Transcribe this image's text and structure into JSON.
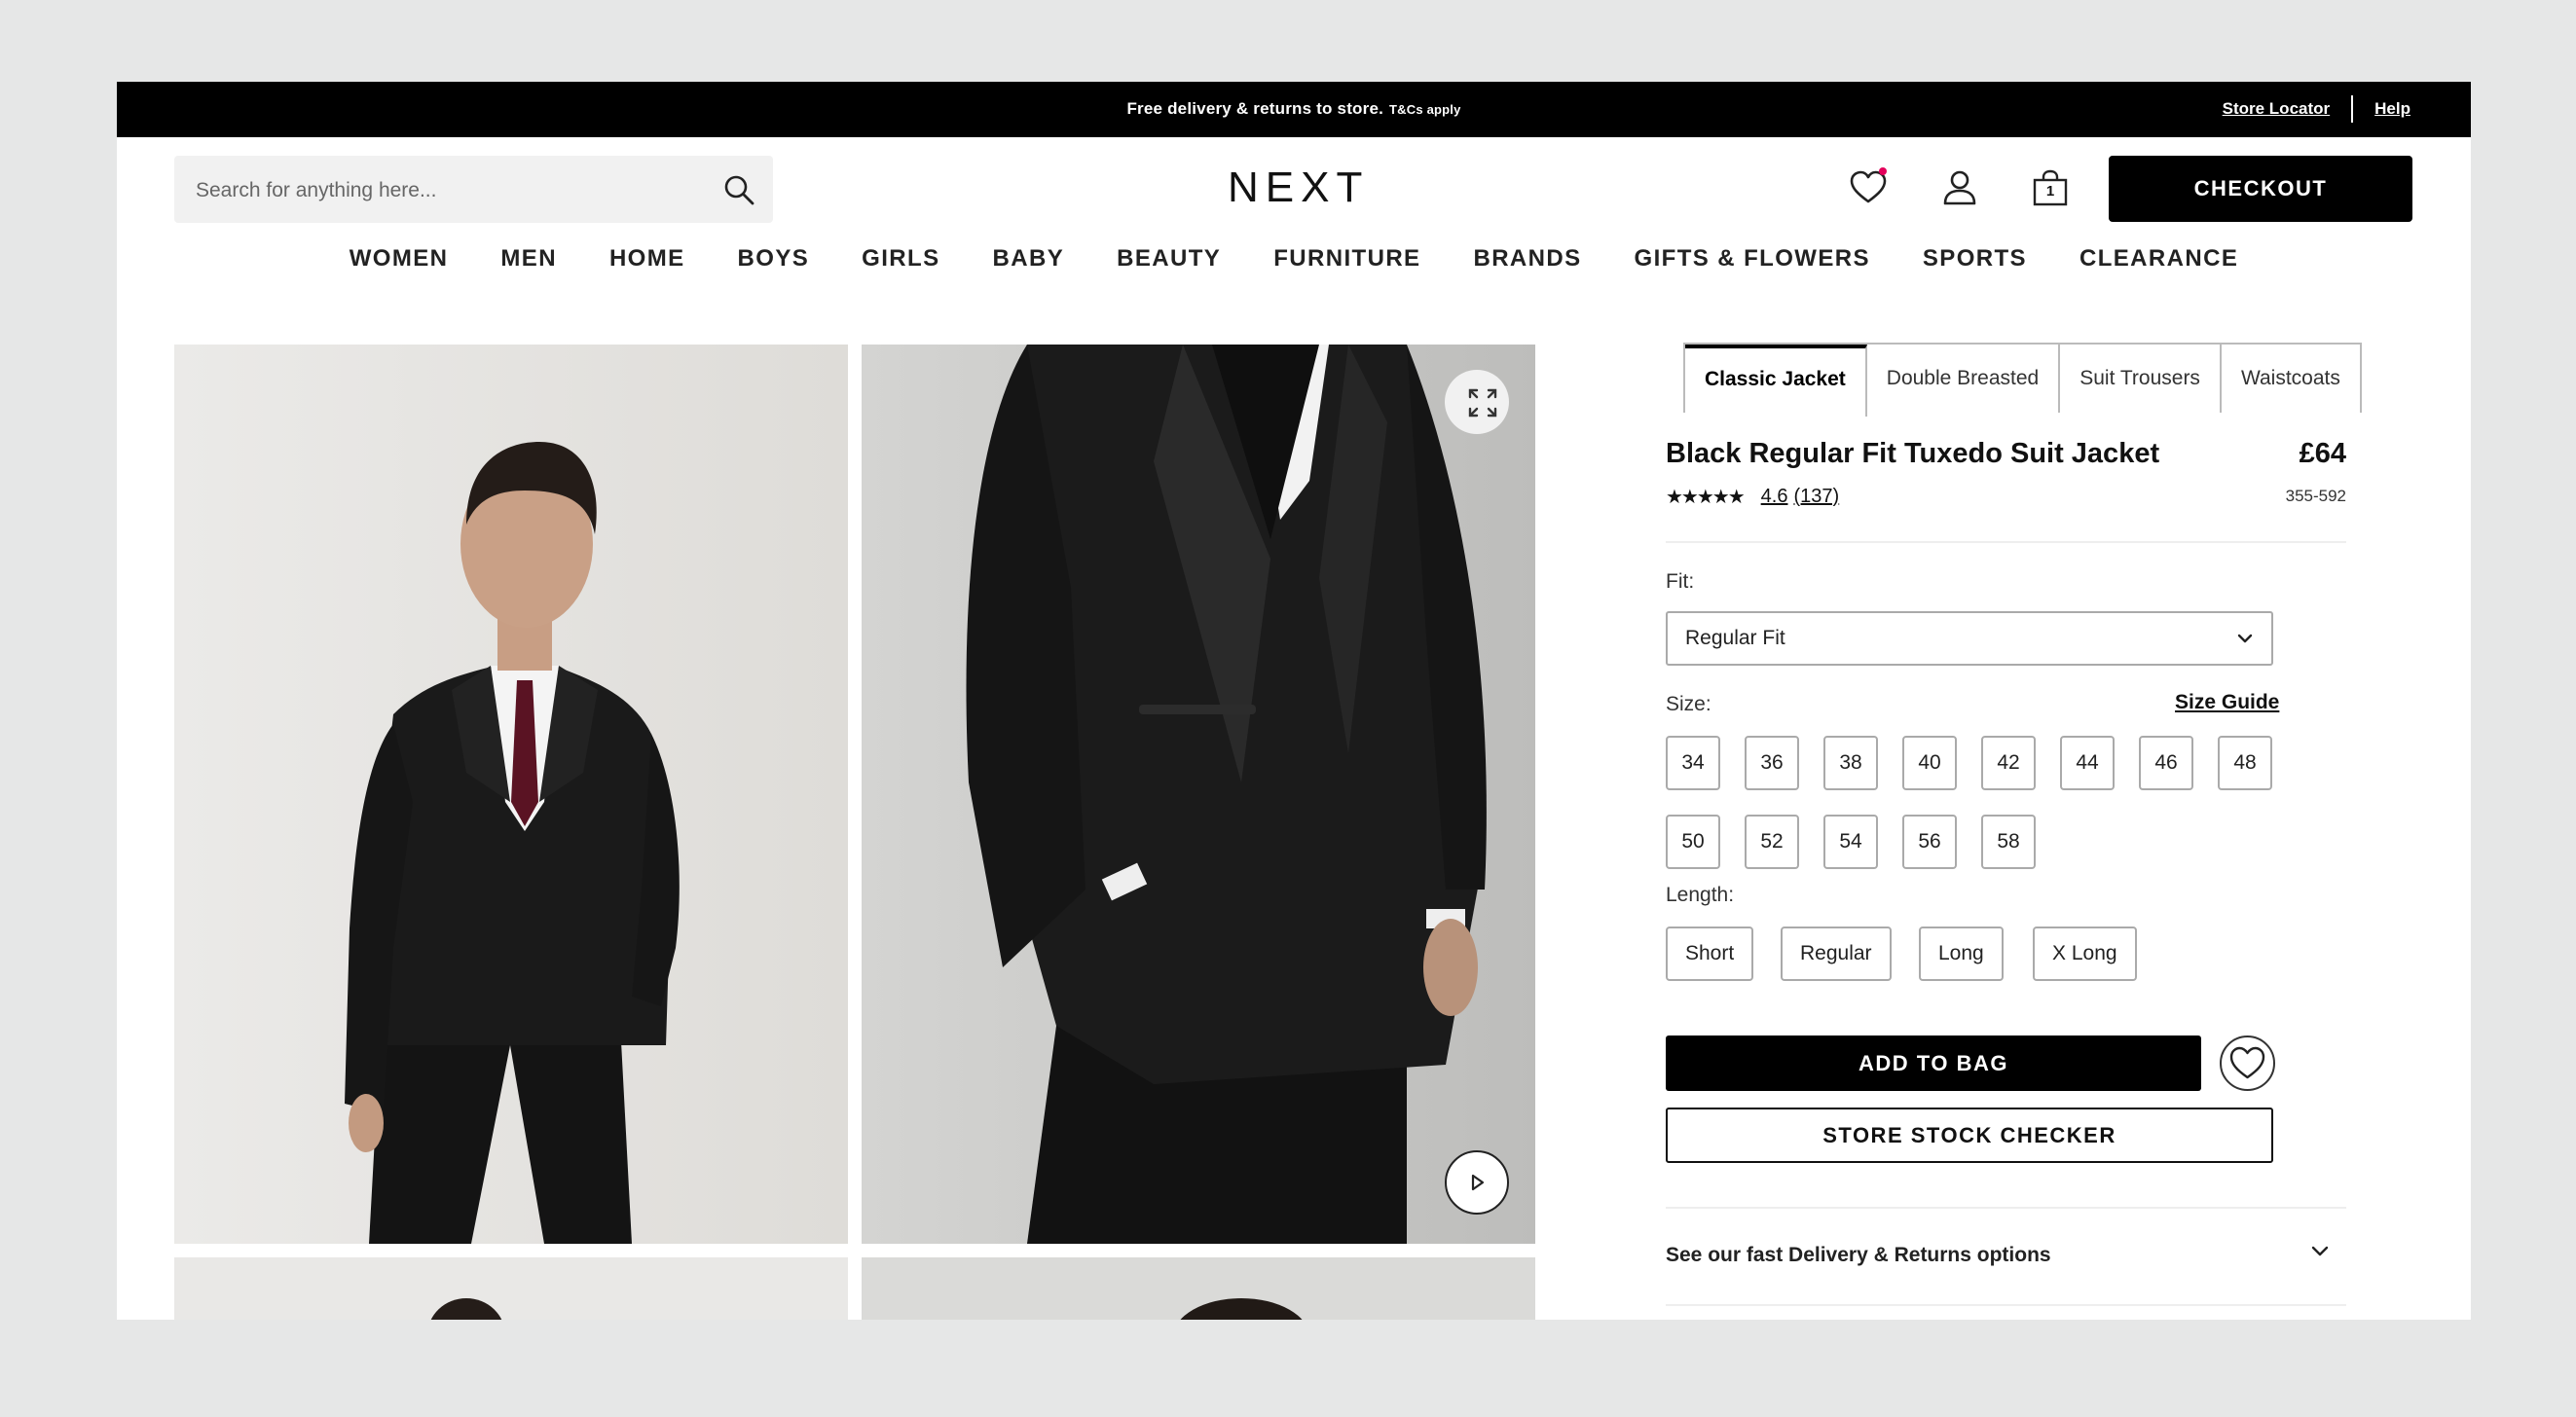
{
  "topbar": {
    "promo": "Free delivery & returns to store.",
    "promo_tcs": "T&Cs apply",
    "store_locator": "Store Locator",
    "help": "Help"
  },
  "header": {
    "search_placeholder": "Search for anything here...",
    "logo": "NEXT",
    "checkout_label": "CHECKOUT",
    "bag_count": "1"
  },
  "nav": [
    "WOMEN",
    "MEN",
    "HOME",
    "BOYS",
    "GIRLS",
    "BABY",
    "BEAUTY",
    "FURNITURE",
    "BRANDS",
    "GIFTS & FLOWERS",
    "SPORTS",
    "CLEARANCE"
  ],
  "product": {
    "tabs": [
      "Classic Jacket",
      "Double Breasted",
      "Suit Trousers",
      "Waistcoats"
    ],
    "active_tab": "Classic Jacket",
    "title": "Black Regular Fit Tuxedo Suit Jacket",
    "price": "£64",
    "stars": "★★★★★",
    "rating": "4.6",
    "review_count": "(137)",
    "code": "355-592",
    "fit_label": "Fit:",
    "fit_value": "Regular Fit",
    "size_label": "Size:",
    "size_guide": "Size Guide",
    "sizes": [
      "34",
      "36",
      "38",
      "40",
      "42",
      "44",
      "46",
      "48",
      "50",
      "52",
      "54",
      "56",
      "58"
    ],
    "length_label": "Length:",
    "lengths": [
      "Short",
      "Regular",
      "Long",
      "X Long"
    ],
    "add_to_bag": "ADD TO BAG",
    "store_stock": "STORE STOCK CHECKER",
    "delivery_text": "See our fast Delivery & Returns options"
  },
  "colors": {
    "accent": "#000000",
    "wishlist_dot": "#e4005b",
    "background": "#e6e7e7"
  }
}
